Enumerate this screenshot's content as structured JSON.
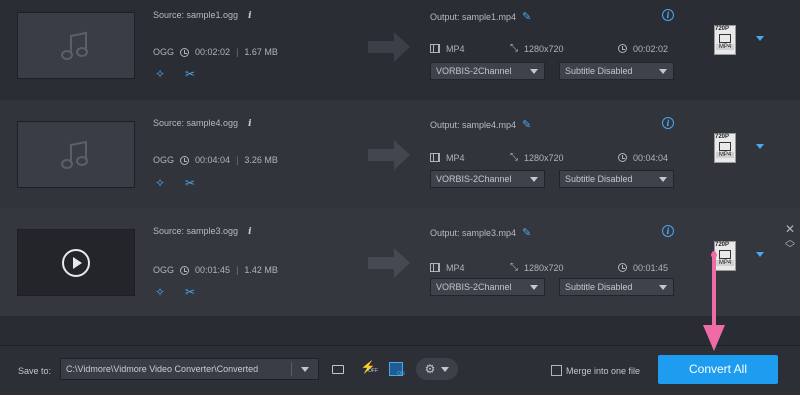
{
  "files": [
    {
      "source_label": "Source: sample1.ogg",
      "info": "i",
      "format": "OGG",
      "duration": "00:02:02",
      "size": "1.67 MB",
      "output_label": "Output: sample1.mp4",
      "out_format": "MP4",
      "out_resolution": "1280x720",
      "out_duration": "00:02:02",
      "audio_track": "VORBIS-2Channel",
      "subtitle": "Subtitle Disabled",
      "badge_res": "720P",
      "badge_type": "MP4",
      "thumb": "music-icon"
    },
    {
      "source_label": "Source: sample4.ogg",
      "info": "i",
      "format": "OGG",
      "duration": "00:04:04",
      "size": "3.26 MB",
      "output_label": "Output: sample4.mp4",
      "out_format": "MP4",
      "out_resolution": "1280x720",
      "out_duration": "00:04:04",
      "audio_track": "VORBIS-2Channel",
      "subtitle": "Subtitle Disabled",
      "badge_res": "720P",
      "badge_type": "MP4",
      "thumb": "music-icon"
    },
    {
      "source_label": "Source: sample3.ogg",
      "info": "i",
      "format": "OGG",
      "duration": "00:01:45",
      "size": "1.42 MB",
      "output_label": "Output: sample3.mp4",
      "out_format": "MP4",
      "out_resolution": "1280x720",
      "out_duration": "00:01:45",
      "audio_track": "VORBIS-2Channel",
      "subtitle": "Subtitle Disabled",
      "badge_res": "720P",
      "badge_type": "MP4",
      "thumb": "play-icon"
    }
  ],
  "bottom": {
    "save_to_label": "Save to:",
    "save_path": "C:\\Vidmore\\Vidmore Video Converter\\Converted",
    "hw_off_label": "OFF",
    "chip_label": "ON",
    "merge_label": "Merge into one file",
    "convert_label": "Convert All"
  },
  "colors": {
    "accent": "#1e9cf0",
    "annotation_arrow": "#f06aa8"
  }
}
